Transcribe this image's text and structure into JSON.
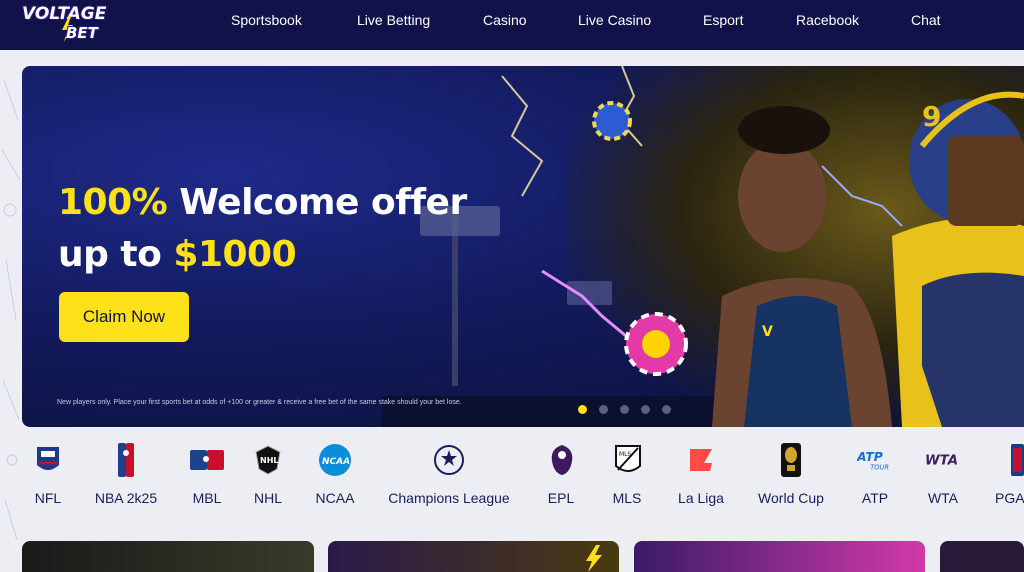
{
  "brand": {
    "line1": "VOLTAGE",
    "line2": "BET"
  },
  "nav": {
    "items": [
      {
        "label": "Sportsbook"
      },
      {
        "label": "Live Betting"
      },
      {
        "label": "Casino"
      },
      {
        "label": "Live Casino"
      },
      {
        "label": "Esport"
      },
      {
        "label": "Racebook"
      },
      {
        "label": "Chat"
      }
    ]
  },
  "hero": {
    "line1_highlight": "100%",
    "line1_rest": " Welcome offer",
    "line2_prefix": "up to ",
    "line2_highlight": "$1000",
    "cta_label": "Claim Now",
    "disclaimer": "New players only. Place your first sports bet at odds of +100 or greater & receive a free bet of the same stake should your bet lose.",
    "slide_count": 5,
    "active_slide": 1
  },
  "leagues": {
    "items": [
      {
        "label": "NFL",
        "icon": "nfl-icon"
      },
      {
        "label": "NBA 2k25",
        "icon": "nba-icon"
      },
      {
        "label": "MBL",
        "icon": "mlb-icon"
      },
      {
        "label": "NHL",
        "icon": "nhl-icon"
      },
      {
        "label": "NCAA",
        "icon": "ncaa-icon"
      },
      {
        "label": "Champions League",
        "icon": "champions-league-icon"
      },
      {
        "label": "EPL",
        "icon": "epl-icon"
      },
      {
        "label": "MLS",
        "icon": "mls-icon"
      },
      {
        "label": "La Liga",
        "icon": "la-liga-icon"
      },
      {
        "label": "World Cup",
        "icon": "world-cup-icon"
      },
      {
        "label": "ATP",
        "icon": "atp-icon"
      },
      {
        "label": "WTA",
        "icon": "wta-icon"
      },
      {
        "label": "PGA",
        "icon": "pga-icon"
      }
    ]
  },
  "colors": {
    "header": "#12124a",
    "accent": "#ffe11a",
    "text": "#1a1d5c"
  }
}
